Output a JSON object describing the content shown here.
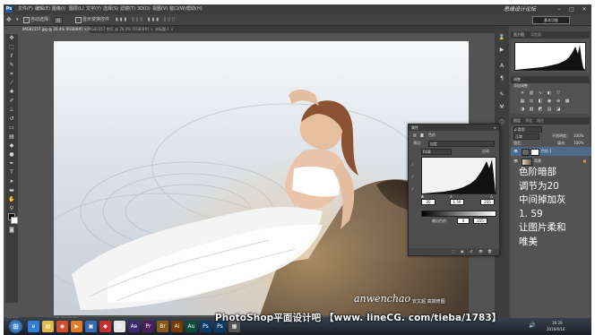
{
  "app": {
    "logo": "Ps",
    "menu": [
      "文件(F)",
      "编辑(E)",
      "图像(I)",
      "图层(L)",
      "文字(Y)",
      "选择(S)",
      "滤镜(T)",
      "3D(D)",
      "视图(V)",
      "窗口(W)",
      "帮助(H)"
    ],
    "watermark_top": "思缘设计论坛",
    "window_controls": [
      "–",
      "□",
      "✕"
    ]
  },
  "options": {
    "auto_select_label": "自动选择：",
    "auto_select_value": "组",
    "show_transform": "显示变换控件",
    "workspace": "基本功能"
  },
  "tabs": [
    {
      "label": "IMG02257.jpg @ 26.4% (RGB/8#) ×",
      "active": true
    },
    {
      "label": "IMG02257 拷贝 @ 26.4% (RGB/8#) ×",
      "active": false
    },
    {
      "label": "未标题-1 ×",
      "active": false
    }
  ],
  "status": {
    "zoom": "26.36%",
    "doc": "文档:31.0M/91.5M"
  },
  "panels": {
    "histogram": {
      "tabs": [
        "直方图",
        "导航器"
      ]
    },
    "adjustments": {
      "title": "调整",
      "subtitle": "添加调整"
    },
    "layers": {
      "tabs": [
        "图层",
        "通道",
        "路径"
      ],
      "blend_mode": "正常",
      "opacity_label": "不透明度:",
      "opacity": "100%",
      "lock_label": "锁定:",
      "fill_label": "填充:",
      "fill": "100%",
      "items": [
        {
          "name": "色阶 1",
          "kind": "adjustment"
        },
        {
          "name": "背景",
          "kind": "image"
        }
      ]
    }
  },
  "levels": {
    "title": "属性",
    "tab": "色阶",
    "preset_label": "预设:",
    "preset_value": "自定",
    "channel": "RGB",
    "auto": "自动",
    "input": [
      "20",
      "1.59",
      "255"
    ],
    "output_label": "输出色阶:",
    "output": [
      "0",
      "255"
    ]
  },
  "annotation": [
    "色阶暗部",
    "调节为20",
    "中间掉加灰",
    "1. 59",
    "让图片柔和",
    "唯美"
  ],
  "signature": {
    "script": "anwenchao",
    "cn": "安文超 高端修图"
  },
  "bottom_watermark": "PhotoShop平面设计吧 【www. lineCG. com/tieba/1783】",
  "taskbar": {
    "time": "16:20",
    "date": "2016/6/16",
    "apps": [
      {
        "name": "ie",
        "color": "#2f7fd6",
        "label": "e"
      },
      {
        "name": "explorer",
        "color": "#e2b84a",
        "label": "▤"
      },
      {
        "name": "browser",
        "color": "#d04e2a",
        "label": "◉"
      },
      {
        "name": "media",
        "color": "#e27a28",
        "label": "▶"
      },
      {
        "name": "app",
        "color": "#3a6ab4",
        "label": "▣"
      },
      {
        "name": "tool",
        "color": "#c53030",
        "label": "◆"
      },
      {
        "name": "qq",
        "color": "#e6e6e6",
        "label": "Q"
      },
      {
        "name": "ae",
        "color": "#3c2a6e",
        "label": "Ae"
      },
      {
        "name": "pr",
        "color": "#4b1f5c",
        "label": "Pr"
      },
      {
        "name": "br",
        "color": "#8a5a1c",
        "label": "Br"
      },
      {
        "name": "ai",
        "color": "#7a3b00",
        "label": "Ai"
      },
      {
        "name": "au",
        "color": "#0a4b3c",
        "label": "Au"
      },
      {
        "name": "ps",
        "color": "#0b3c66",
        "label": "Ps"
      },
      {
        "name": "ps2",
        "color": "#0b3c66",
        "label": "Ps"
      },
      {
        "name": "app2",
        "color": "#555",
        "label": "▦"
      }
    ]
  }
}
